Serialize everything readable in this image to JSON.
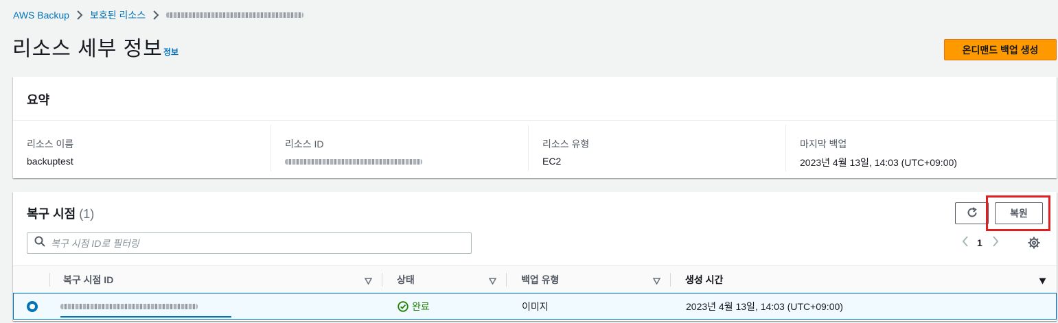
{
  "breadcrumb": {
    "items": [
      "AWS Backup",
      "보호된 리소스"
    ]
  },
  "header": {
    "title": "리소스 세부 정보",
    "info_link": "정보",
    "on_demand_button": "온디맨드 백업 생성"
  },
  "summary": {
    "title": "요약",
    "fields": [
      {
        "label": "리소스 이름",
        "value": "backuptest"
      },
      {
        "label": "리소스 ID",
        "value": ""
      },
      {
        "label": "리소스 유형",
        "value": "EC2"
      },
      {
        "label": "마지막 백업",
        "value": "2023년 4월 13일, 14:03 (UTC+09:00)"
      }
    ]
  },
  "recovery_points": {
    "title": "복구 시점",
    "count": "(1)",
    "restore_button": "복원",
    "filter_placeholder": "복구 시점 ID로 필터링",
    "page": "1",
    "columns": [
      "복구 시점 ID",
      "상태",
      "백업 유형",
      "생성 시간"
    ],
    "rows": [
      {
        "status": "완료",
        "backup_type": "이미지",
        "created": "2023년 4월 13일, 14:03 (UTC+09:00)"
      }
    ]
  },
  "colors": {
    "link": "#0073bb",
    "primary": "#ff9900",
    "success": "#1d8102",
    "highlight": "#e01e1e"
  },
  "icons": [
    "chevron-right-icon",
    "refresh-icon",
    "search-icon",
    "chevron-left-icon",
    "gear-icon",
    "sort-icon",
    "check-circle-icon"
  ]
}
